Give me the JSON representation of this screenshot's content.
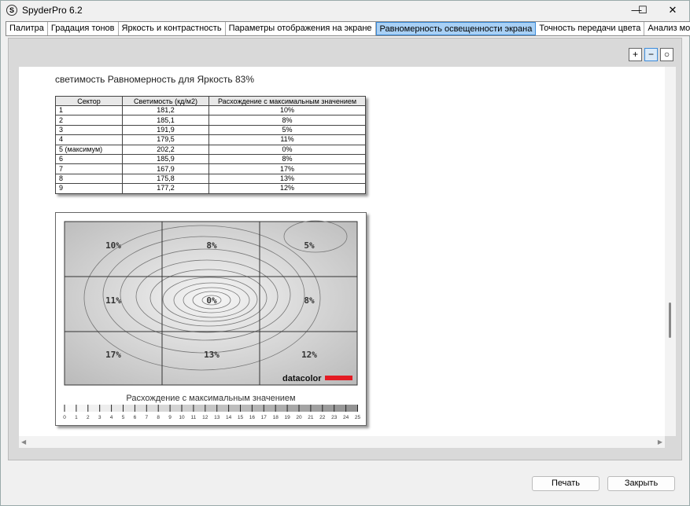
{
  "window": {
    "title": "SpyderPro 6.2",
    "logo": "S",
    "min": "—",
    "max": "☐",
    "close": "✕"
  },
  "tabs": [
    "Палитра",
    "Градация тонов",
    "Яркость и контрастность",
    "Параметры отображения на экране",
    "Равномерность освещенности экрана",
    "Точность передачи цвета",
    "Анализ монитора"
  ],
  "active_tab": 4,
  "zoom": {
    "in": "+",
    "out": "−",
    "fit": "○"
  },
  "report": {
    "title": "светимость Равномерность для Яркость 83%",
    "headers": [
      "Сектор",
      "Светимость (кд/м2)",
      "Расхождение с максимальным значением"
    ],
    "rows": [
      [
        "1",
        "181,2",
        "10%"
      ],
      [
        "2",
        "185,1",
        "8%"
      ],
      [
        "3",
        "191,9",
        "5%"
      ],
      [
        "4",
        "179,5",
        "11%"
      ],
      [
        "5 (максимум)",
        "202,2",
        "0%"
      ],
      [
        "6",
        "185,9",
        "8%"
      ],
      [
        "7",
        "167,9",
        "17%"
      ],
      [
        "8",
        "175,8",
        "13%"
      ],
      [
        "9",
        "177,2",
        "12%"
      ]
    ],
    "map_labels": [
      "10%",
      "8%",
      "5%",
      "11%",
      "0%",
      "8%",
      "17%",
      "13%",
      "12%"
    ],
    "brand": "datacolor",
    "legend_title": "Расхождение с максимальным значением",
    "scale": [
      "0",
      "1",
      "2",
      "3",
      "4",
      "5",
      "6",
      "7",
      "8",
      "9",
      "10",
      "11",
      "12",
      "13",
      "14",
      "15",
      "16",
      "17",
      "18",
      "19",
      "20",
      "21",
      "22",
      "23",
      "24",
      "25"
    ]
  },
  "buttons": {
    "print": "Печать",
    "close": "Закрыть"
  }
}
